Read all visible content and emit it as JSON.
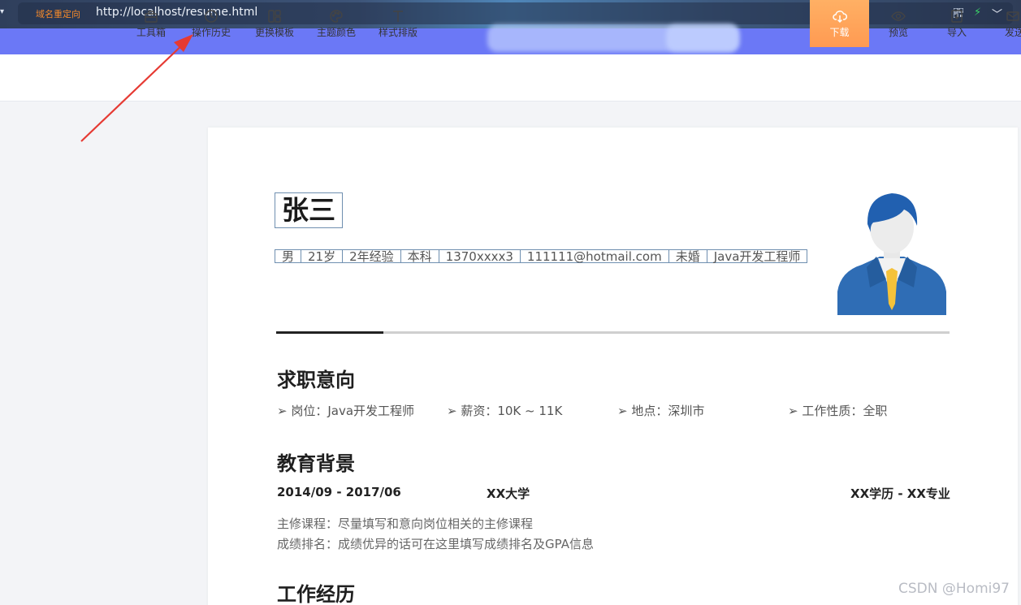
{
  "browser": {
    "back_glyph": "▾",
    "redirect_label": "域名重定向",
    "url": "http://localhost/resume.html"
  },
  "toolbar": {
    "items": [
      {
        "label": "工具箱",
        "icon": "toolbox-icon"
      },
      {
        "label": "操作历史",
        "icon": "clock-icon"
      },
      {
        "label": "更换模板",
        "icon": "template-icon"
      },
      {
        "label": "主题颜色",
        "icon": "palette-icon"
      },
      {
        "label": "样式排版",
        "icon": "text-style-icon"
      }
    ],
    "right_items": [
      {
        "label": "下载",
        "icon": "cloud-download-icon"
      },
      {
        "label": "预览",
        "icon": "eye-icon"
      },
      {
        "label": "导入",
        "icon": "import-icon"
      },
      {
        "label": "发送",
        "icon": "mail-icon"
      }
    ],
    "accent_color": "#ff9f57"
  },
  "resume": {
    "name": "张三",
    "info": [
      "男",
      "21岁",
      "2年经验",
      "本科",
      "1370xxxx3",
      "111111@hotmail.com",
      "未婚",
      "Java开发工程师"
    ],
    "sections": {
      "intent_title": "求职意向",
      "intent_items": [
        "➢ 岗位：Java开发工程师",
        "➢ 薪资：10K ~ 11K",
        "➢ 地点：深圳市",
        "➢ 工作性质：全职"
      ],
      "education_title": "教育背景",
      "edu_period": "2014/09 - 2017/06",
      "edu_school": "XX大学",
      "edu_degree": "XX学历 - XX专业",
      "edu_courses": "主修课程：尽量填写和意向岗位相关的主修课程",
      "edu_rank": "成绩排名：成绩优异的话可在这里填写成绩排名及GPA信息",
      "work_title": "工作经历"
    }
  },
  "watermark": "CSDN @Homi97",
  "colors": {
    "band": "#6b78f6",
    "annotation_arrow": "#e63a33"
  }
}
